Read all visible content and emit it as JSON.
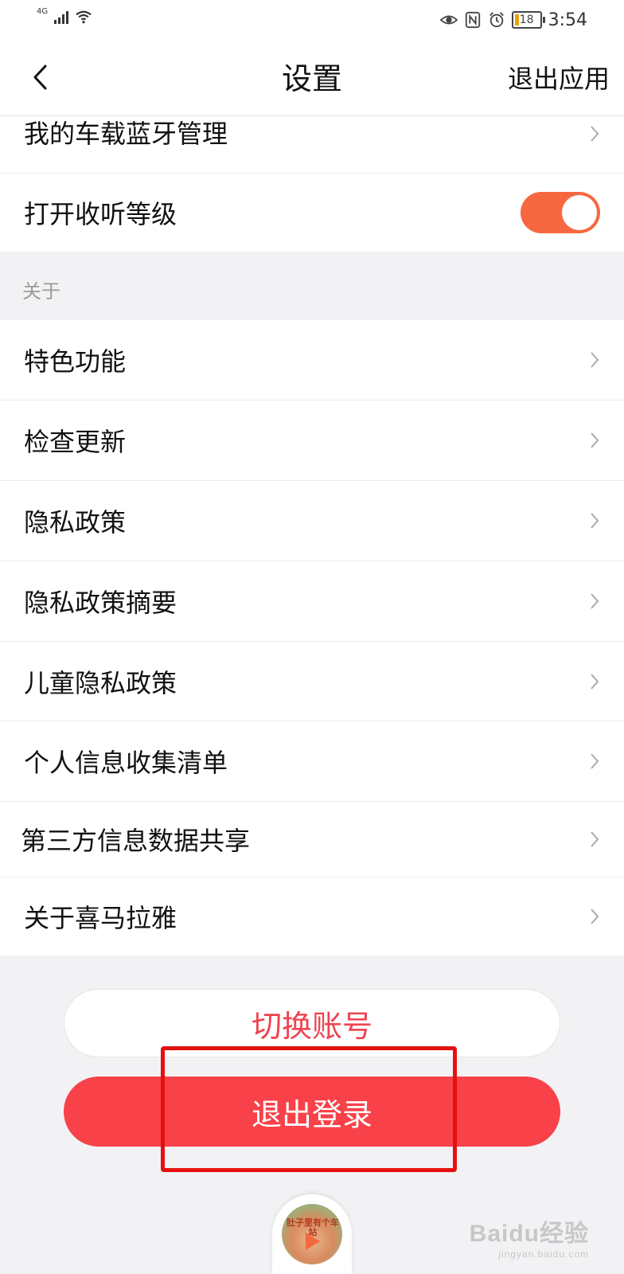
{
  "status_bar": {
    "network": "4G",
    "battery": "18",
    "time": "3:54"
  },
  "header": {
    "title": "设置",
    "exit_app": "退出应用"
  },
  "settings_top": {
    "bluetooth": "我的车载蓝牙管理",
    "listening_level": "打开收听等级",
    "listening_level_on": true
  },
  "about_section": {
    "label": "关于",
    "items": [
      "特色功能",
      "检查更新",
      "隐私政策",
      "隐私政策摘要",
      "儿童隐私政策",
      "个人信息收集清单",
      "第三方信息数据共享",
      "关于喜马拉雅"
    ]
  },
  "buttons": {
    "switch_account": "切换账号",
    "logout": "退出登录"
  },
  "mini_player": {
    "album_title": "肚子里有个车站"
  },
  "watermark": {
    "main": "Baidu经验",
    "sub": "jingyan.baidu.com"
  },
  "colors": {
    "accent": "#f5683f",
    "logout_bg": "#f84149",
    "switch_text": "#f0434f",
    "highlight": "#e51010"
  }
}
